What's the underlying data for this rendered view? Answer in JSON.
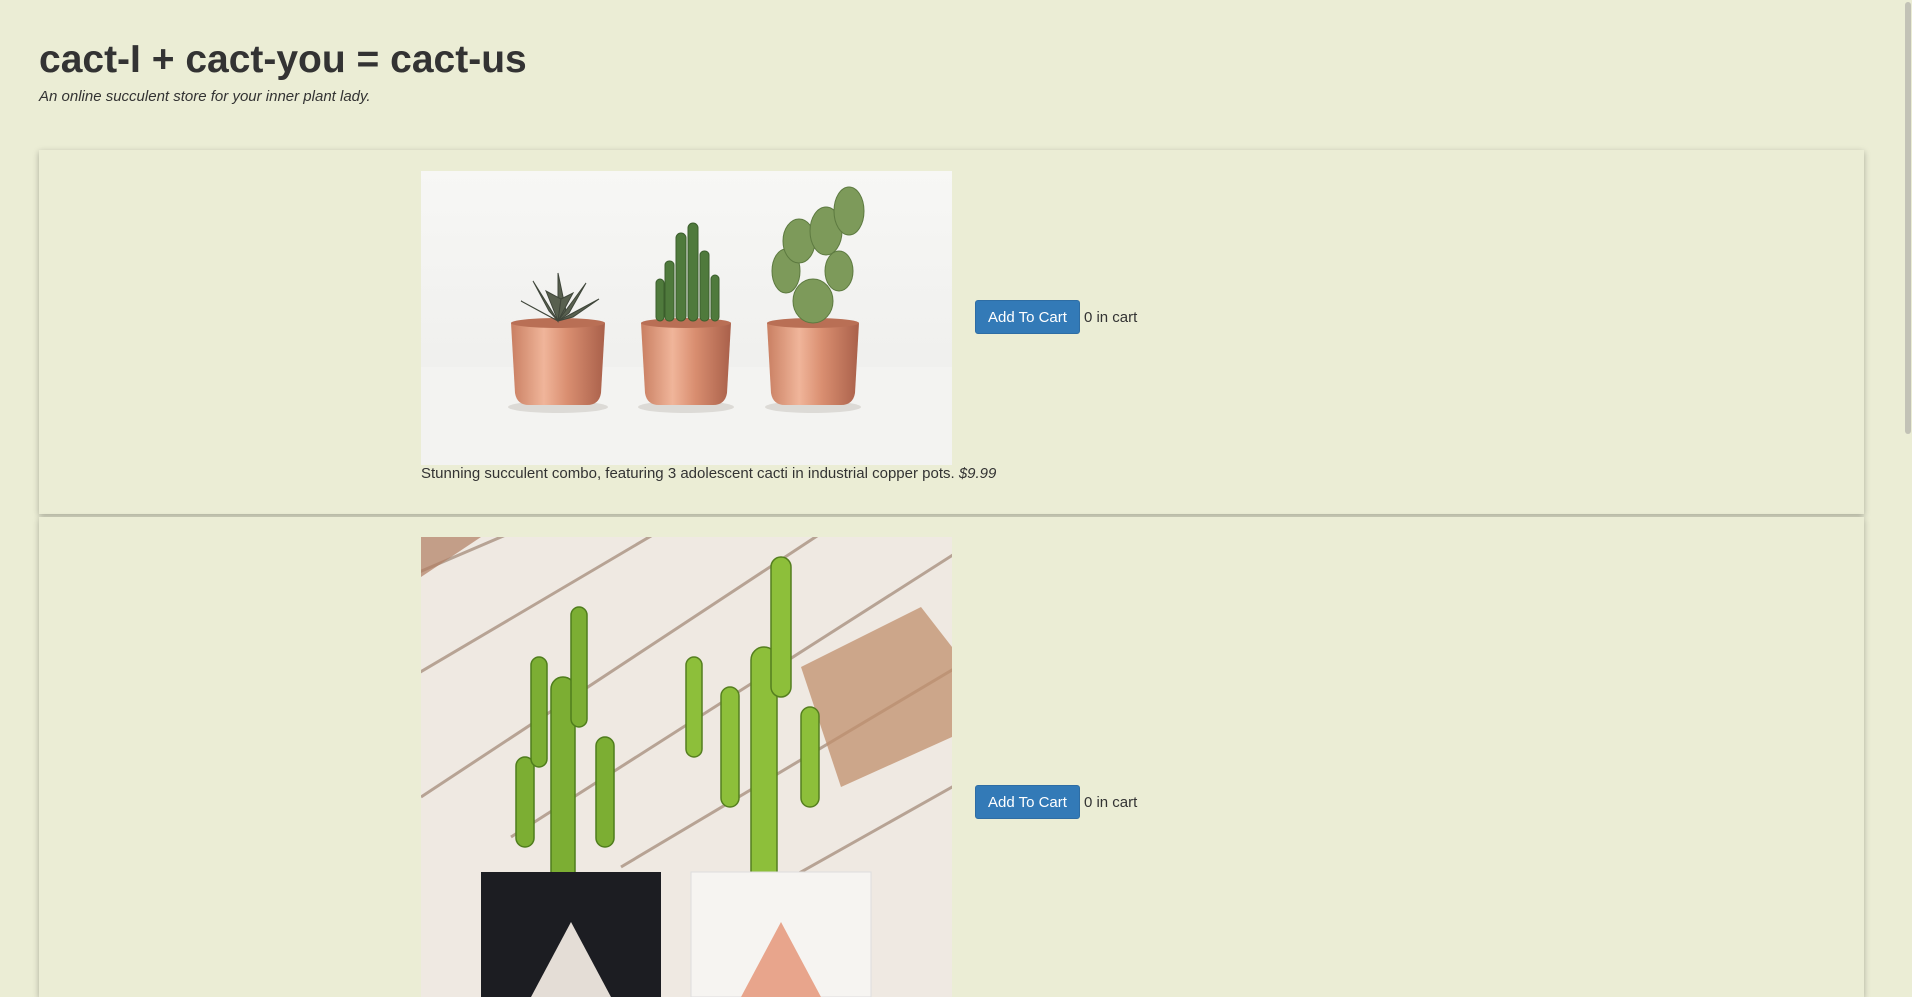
{
  "header": {
    "title": "cact-I + cact-you = cact-us",
    "tagline": "An online succulent store for your inner plant lady."
  },
  "products": [
    {
      "image_alt": "Three succulents in copper pots",
      "button_label": "Add To Cart",
      "cart_count": "0 in cart",
      "description": "Stunning succulent combo, featuring 3 adolescent cacti in industrial copper pots.",
      "price": "$9.99"
    },
    {
      "image_alt": "Two tall cacti in geometric pots",
      "button_label": "Add To Cart",
      "cart_count": "0 in cart"
    }
  ]
}
